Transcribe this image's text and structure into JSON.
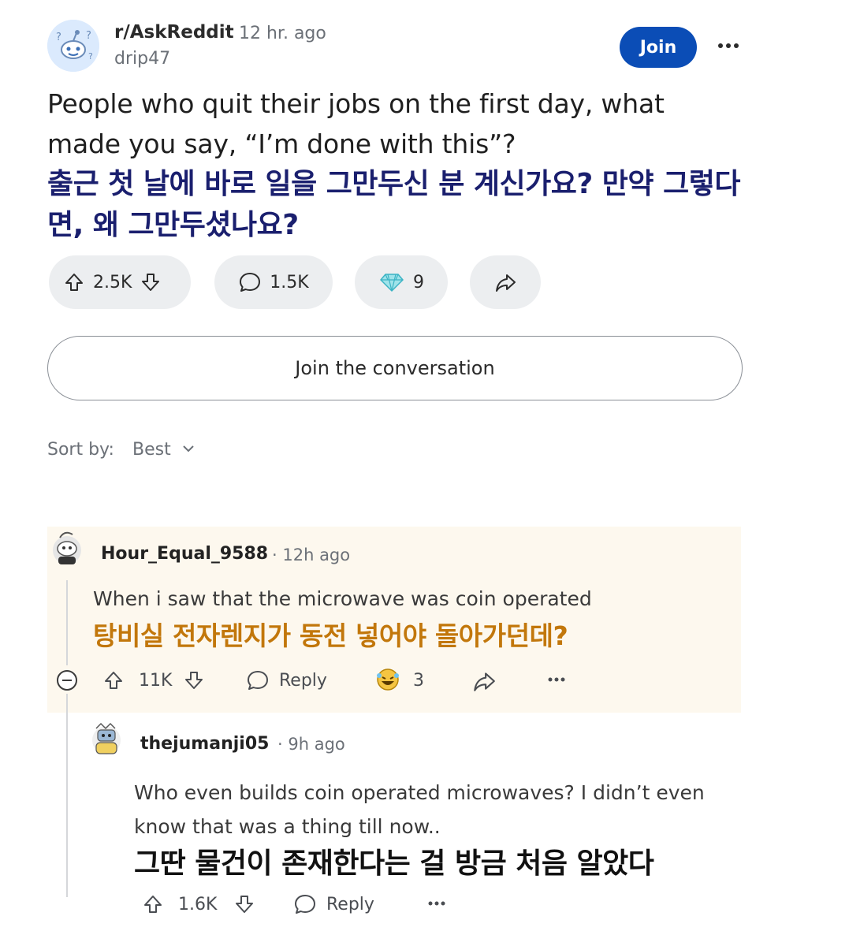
{
  "post": {
    "subreddit": "r/AskReddit",
    "time": "12 hr. ago",
    "author": "drip47",
    "join_label": "Join",
    "title_en": "People who quit their jobs on the first day, what made you say, “I’m done with this”?",
    "title_ko": "출근 첫 날에 바로 일을 그만두신 분 계신가요? 만약 그렇다면, 왜 그만두셨나요?",
    "upvotes": "2.5K",
    "comments": "1.5K",
    "awards": "9",
    "icons": [
      "upvote-icon",
      "downvote-icon",
      "comment-icon",
      "diamond-award-icon",
      "share-icon",
      "more-icon"
    ]
  },
  "join_conversation": "Join the conversation",
  "sort": {
    "label": "Sort by:",
    "value": "Best"
  },
  "comments": [
    {
      "username": "Hour_Equal_9588",
      "time": "12h ago",
      "text_en": "When i saw that the microwave was coin operated",
      "text_ko": "탕비실 전자렌지가 동전 넣어야 돌아가던데?",
      "votes": "11K",
      "reply_label": "Reply",
      "awards": "3",
      "highlight_color": "#fdf8ee",
      "translation_color": "#c2770b"
    },
    {
      "username": "thejumanji05",
      "time": "9h ago",
      "text_en": "Who even builds coin operated microwaves? I didn’t even know that was a thing till now..",
      "text_ko": "그딴 물건이 존재한다는 걸 방금 처음 알았다",
      "votes": "1.6K",
      "reply_label": "Reply"
    }
  ],
  "colors": {
    "join_button": "#0b4db6",
    "title_ko": "#1a1f6e",
    "pill_bg": "#eceef0"
  }
}
